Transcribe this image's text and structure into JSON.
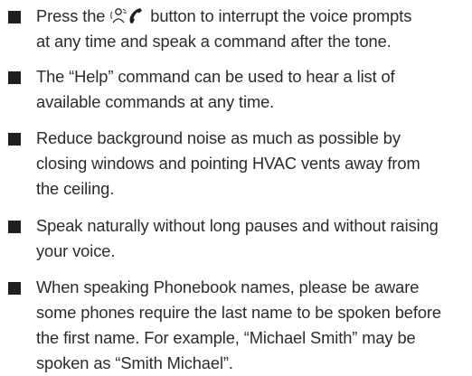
{
  "tips": [
    {
      "lines": [
        [
          "Press the ",
          "voice-command-icon",
          "phone-icon",
          " button to interrupt the voice prompts"
        ],
        [
          "at any time and speak a command after the tone."
        ]
      ]
    },
    {
      "lines": [
        [
          "The “Help” command can be used to hear a list of"
        ],
        [
          "available commands at any time."
        ]
      ]
    },
    {
      "lines": [
        [
          "Reduce background noise as much as possible by"
        ],
        [
          "closing windows and pointing HVAC vents away from"
        ],
        [
          "the ceiling."
        ]
      ]
    },
    {
      "lines": [
        [
          "Speak naturally without long pauses and without raising"
        ],
        [
          "your voice."
        ]
      ]
    },
    {
      "lines": [
        [
          "When speaking Phonebook names, please be aware"
        ],
        [
          "some phones require the last name to be spoken before"
        ],
        [
          "the first name. For example, “Michael Smith” may be"
        ],
        [
          "spoken as “Smith Michael”."
        ]
      ]
    }
  ],
  "colors": {
    "text": "#2b2b2b",
    "bullet": "#1f1f1f",
    "background": "#ffffff"
  }
}
